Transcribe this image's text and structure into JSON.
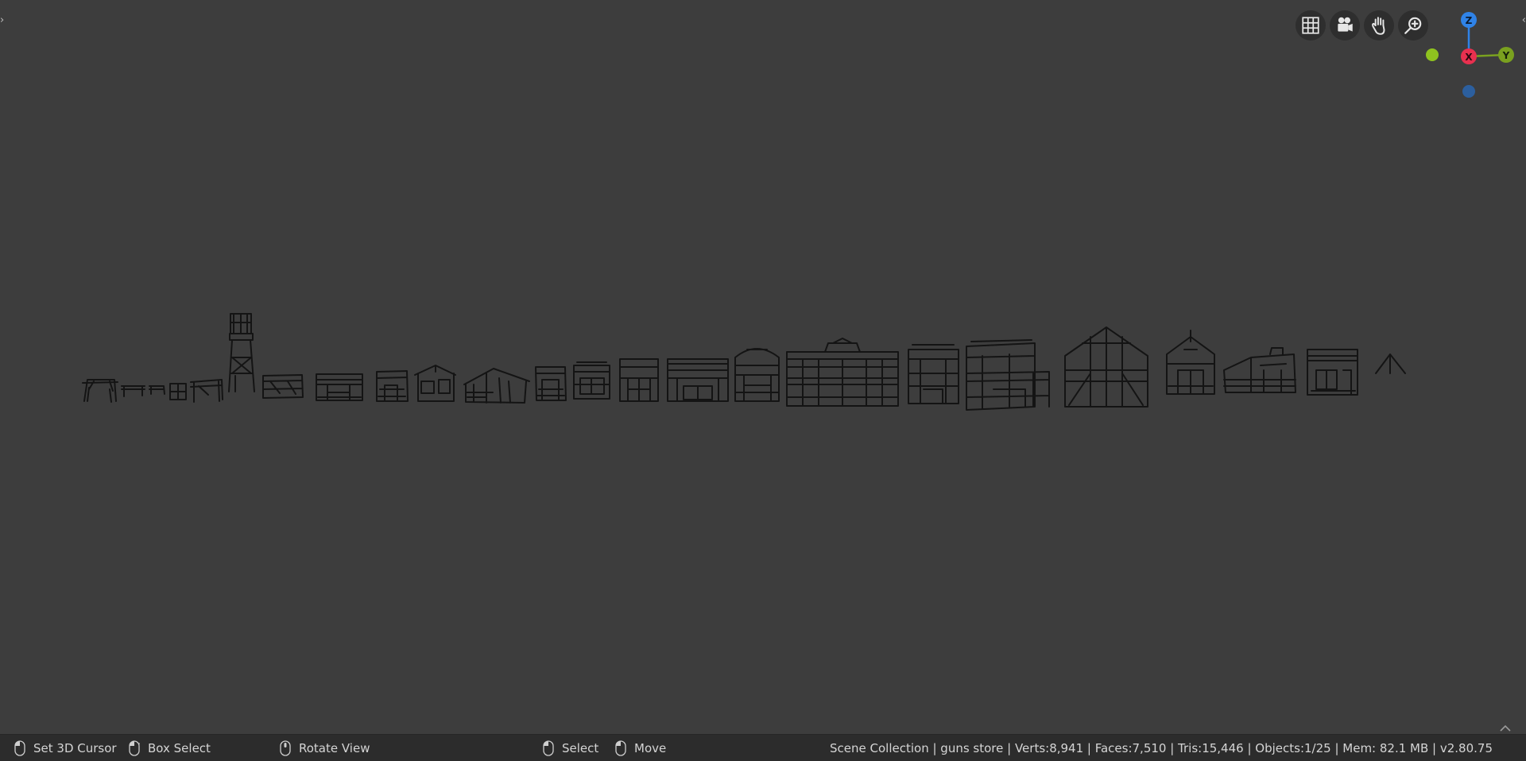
{
  "navigation": {
    "buttons": [
      {
        "name": "toggle-grid-view",
        "icon": "grid-icon"
      },
      {
        "name": "toggle-camera-view",
        "icon": "camera-icon"
      },
      {
        "name": "pan-view",
        "icon": "hand-icon"
      },
      {
        "name": "zoom-view",
        "icon": "zoom-icon"
      }
    ]
  },
  "gizmo": {
    "z_label": "Z",
    "y_label": "Y",
    "x_label": "X",
    "colors": {
      "z": "#2f83e8",
      "y": "#7aa11f",
      "x": "#e8304f",
      "neg_y": "#8fc31f",
      "neg_z": "#2c5f9e"
    }
  },
  "viewport": {
    "background": "#3d3d3d",
    "objects": [
      "gallows",
      "table",
      "short-table",
      "bench",
      "porch",
      "water-tower",
      "shack",
      "store-1",
      "small-house",
      "gabled-house",
      "barn-shed",
      "cabin",
      "box-house",
      "store-2",
      "store-3",
      "arched-store",
      "saloon",
      "storefront-tall",
      "guns-store",
      "church-barn",
      "chapel",
      "lean-to-house",
      "flat-store",
      "empty-axes"
    ]
  },
  "statusbar": {
    "set_cursor": "Set 3D Cursor",
    "box_select": "Box Select",
    "rotate_view": "Rotate View",
    "select": "Select",
    "move": "Move",
    "stats": "Scene Collection | guns store | Verts:8,941 | Faces:7,510 | Tris:15,446 | Objects:1/25 | Mem: 82.1 MB | v2.80.75"
  }
}
